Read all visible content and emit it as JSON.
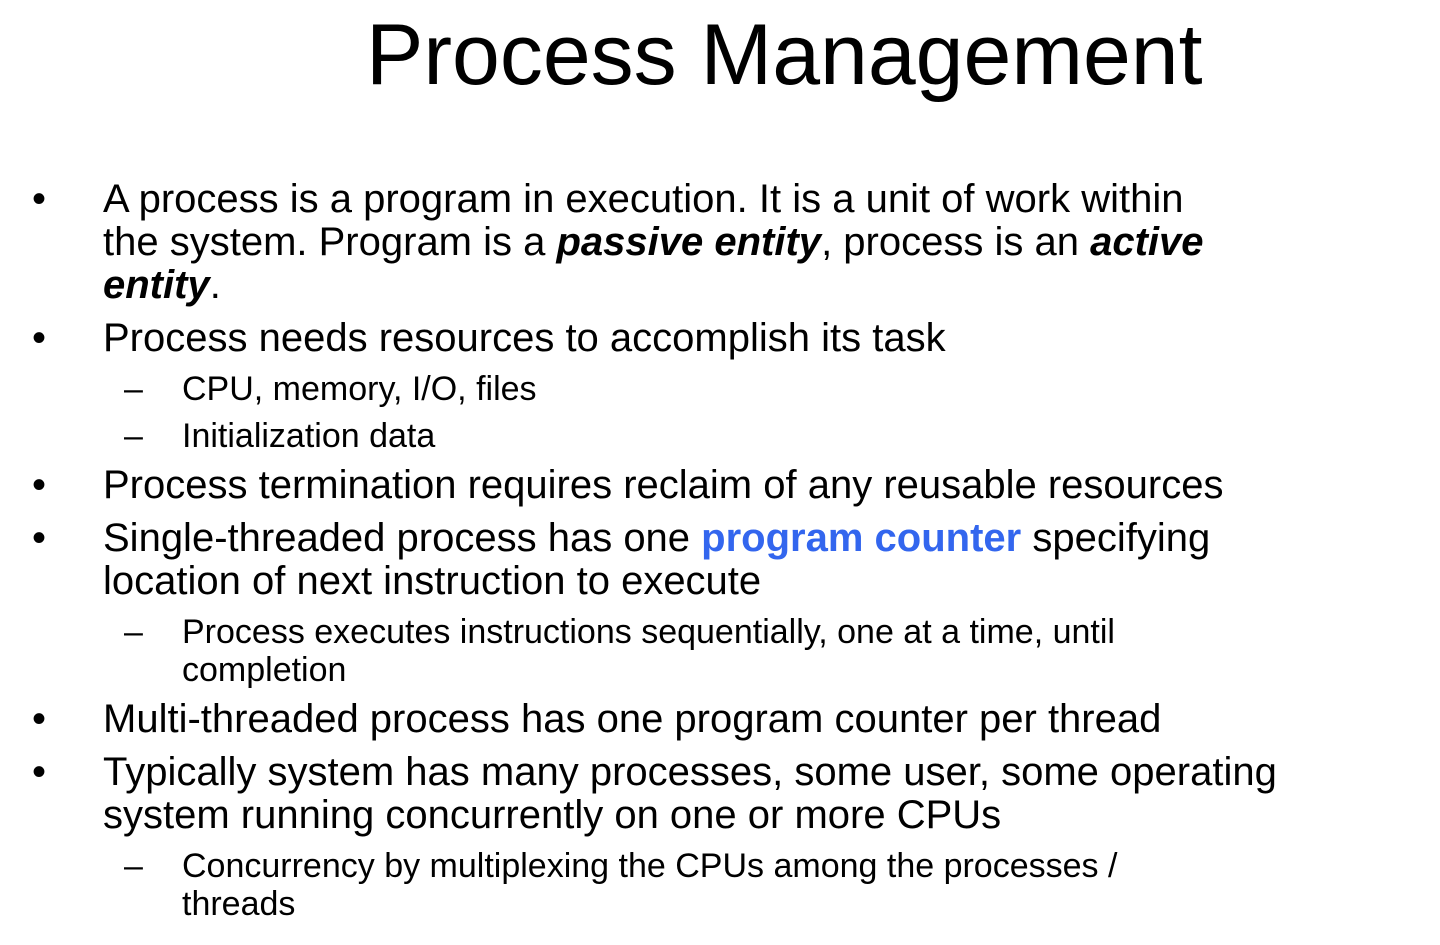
{
  "slide": {
    "title": "Process Management",
    "bullet_symbol": "•",
    "dash_symbol": "–",
    "highlight_color": "#3366ee",
    "items": [
      {
        "line1": "A process is a program in execution. It is a unit of work within",
        "line2_a": "the system. Program is a ",
        "line2_em1": "passive entity",
        "line2_b": ", process is an ",
        "line2_em2": "active",
        "line3_em": "entity",
        "line3_b": "."
      },
      {
        "text": "Process needs resources to accomplish its task",
        "subitems": [
          "CPU, memory, I/O, files",
          "Initialization data"
        ]
      },
      {
        "text": "Process termination requires reclaim of any reusable resources"
      },
      {
        "line1_a": "Single-threaded process has one ",
        "line1_highlight": "program counter",
        "line1_b": " specifying",
        "line2": "location of next instruction to execute",
        "subitems": [
          {
            "line1": "Process executes instructions sequentially, one at a time, until",
            "line2": "completion"
          }
        ]
      },
      {
        "text": "Multi-threaded process has one program counter per thread"
      },
      {
        "line1": "Typically system has many processes, some user, some operating",
        "line2": "system running concurrently on one or more CPUs",
        "subitems": [
          {
            "line1": "Concurrency by multiplexing the CPUs among the processes /",
            "line2": "threads"
          }
        ]
      }
    ]
  }
}
